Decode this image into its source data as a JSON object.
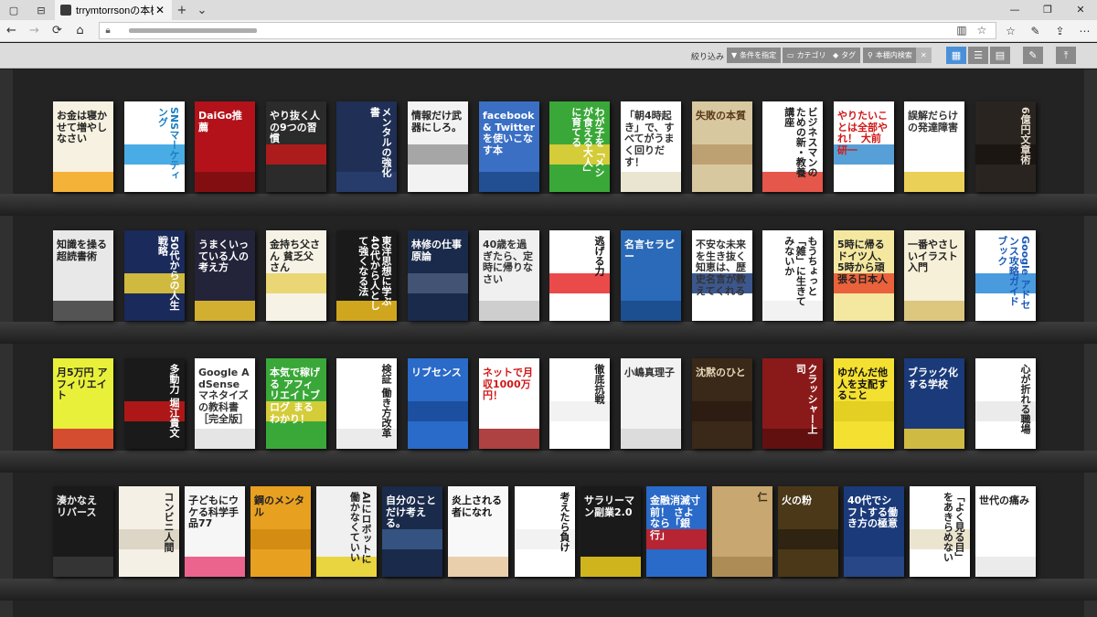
{
  "browser": {
    "tab_title": "trrymtorrsonの本棚 (trry",
    "tab_close": "✕",
    "new_tab": "+",
    "tab_menu": "⌄",
    "win_min": "—",
    "win_max": "❐",
    "win_close": "✕",
    "nav": {
      "back": "←",
      "forward": "→",
      "refresh": "⟳",
      "home": "⌂"
    },
    "address_icons": {
      "reading": "▥",
      "favorite": "☆"
    },
    "tools": [
      "☆",
      "✎",
      "⇪",
      "⋯"
    ]
  },
  "toolbar": {
    "filter_label": "絞り込み",
    "buttons": [
      {
        "icon": "▼",
        "label": "条件を指定"
      },
      {
        "icon": "▭",
        "label": "カテゴリ"
      },
      {
        "icon": "◆",
        "label": "タグ"
      },
      {
        "icon": "⚲",
        "label": "本棚内検索"
      }
    ],
    "clear": "✕",
    "views": [
      "▦",
      "☰",
      "▤"
    ],
    "settings": "✎",
    "top": "⤒"
  },
  "colors": {
    "accent": "#4a90d9",
    "shelf": "#232323"
  },
  "shelves": [
    {
      "books": [
        {
          "title": "お金は寝かせて増やしなさい",
          "bg": "#f6f1e0",
          "fg": "#222222",
          "band": "#f4a71b"
        },
        {
          "title": "SNSマーケティング",
          "bg": "#ffffff",
          "fg": "#1a7fc0",
          "band": "#2a9de0"
        },
        {
          "title": "DaiGo推薦",
          "bg": "#b3121a",
          "fg": "#ffffff",
          "band": "#7a0e12"
        },
        {
          "title": "やり抜く人の9つの習慣",
          "bg": "#2b2b2b",
          "fg": "#ffffff",
          "band": "#c41a1a"
        },
        {
          "title": "メンタルの強化書",
          "bg": "#1f2f55",
          "fg": "#ffffff",
          "band": "#2a3e70"
        },
        {
          "title": "情報だけ武器にしろ。",
          "bg": "#f2f2f2",
          "fg": "#222222",
          "band": "#999999"
        },
        {
          "title": "facebook & Twitterを使いこなす本",
          "bg": "#3a6fc4",
          "fg": "#ffffff",
          "band": "#1d4a8a"
        },
        {
          "title": "わが子を「メシが食える大人」に育てる",
          "bg": "#3aa838",
          "fg": "#ffffff",
          "band": "#f0d23a"
        },
        {
          "title": "「朝4時起き」で、すべてがうまく回りだす！",
          "bg": "#ffffff",
          "fg": "#333333",
          "band": "#e6e0c8"
        },
        {
          "title": "失敗の本質",
          "bg": "#d8c8a0",
          "fg": "#5a3a1a",
          "band": "#b89a6a"
        },
        {
          "title": "ビジネスマンのための新・教養講座",
          "bg": "#ffffff",
          "fg": "#222222",
          "band": "#e03a2a"
        },
        {
          "title": "やりたいことは全部やれ！ 大前研一",
          "bg": "#ffffff",
          "fg": "#d01818",
          "band": "#3a8fd0"
        },
        {
          "title": "誤解だらけの発達障害",
          "bg": "#ffffff",
          "fg": "#333333",
          "band": "#e8c83a"
        },
        {
          "title": "6億円文章術",
          "bg": "#2a2420",
          "fg": "#e8e0d0",
          "band": "#1a1410"
        }
      ]
    },
    {
      "books": [
        {
          "title": "知識を操る超読書術",
          "bg": "#e8e8e8",
          "fg": "#222222",
          "band": "#3a3a3a"
        },
        {
          "title": "50代からの人生戦略",
          "bg": "#1a2a5a",
          "fg": "#ffffff",
          "band": "#f0d23a"
        },
        {
          "title": "うまくいっている人の考え方",
          "bg": "#23233a",
          "fg": "#ffffff",
          "band": "#f2c830"
        },
        {
          "title": "金持ち父さん 貧乏父さん",
          "bg": "#f6f3e6",
          "fg": "#222222",
          "band": "#e8d060"
        },
        {
          "title": "東洋思想に学ぶ 40代から人として強くなる法",
          "bg": "#1a1a1a",
          "fg": "#ffffff",
          "band": "#f0c020"
        },
        {
          "title": "林修の仕事原論",
          "bg": "#1a2a4a",
          "fg": "#ffffff",
          "band": "#4a5a7a"
        },
        {
          "title": "40歳を過ぎたら、定時に帰りなさい",
          "bg": "#f0f0f0",
          "fg": "#333333",
          "band": "#c8c8c8"
        },
        {
          "title": "逃げる力",
          "bg": "#ffffff",
          "fg": "#111111",
          "band": "#e82a2a"
        },
        {
          "title": "名言セラピー",
          "bg": "#2a6ab8",
          "fg": "#ffffff",
          "band": "#1a4a88"
        },
        {
          "title": "不安な未来を生き抜く知恵は、歴史名言が教えてくれる",
          "bg": "#ffffff",
          "fg": "#333333",
          "band": "#1a3a7a"
        },
        {
          "title": "もうちょっと「雑」に生きてみないか",
          "bg": "#ffffff",
          "fg": "#222222",
          "band": "#f0f0f0"
        },
        {
          "title": "5時に帰るドイツ人、5時から頑張る日本人",
          "bg": "#f4e8a0",
          "fg": "#222222",
          "band": "#e84a2a"
        },
        {
          "title": "一番やさしいイラスト入門",
          "bg": "#f6f0d8",
          "fg": "#222222",
          "band": "#d8c070"
        },
        {
          "title": "Google アドセンス攻略ガイドブック",
          "bg": "#ffffff",
          "fg": "#1a5ab8",
          "band": "#2a8ad8"
        }
      ]
    },
    {
      "books": [
        {
          "title": "月5万円 アフィリエイト",
          "bg": "#e8f03a",
          "fg": "#222222",
          "band": "#d03030"
        },
        {
          "title": "多動力 堀江貴文",
          "bg": "#1a1a1a",
          "fg": "#ffffff",
          "band": "#c81818"
        },
        {
          "title": "Google AdSense マネタイズの教科書［完全版］",
          "bg": "#ffffff",
          "fg": "#333333",
          "band": "#e0e0e0"
        },
        {
          "title": "本気で稼げる アフィリエイトブログ まるわかり！",
          "bg": "#3aa838",
          "fg": "#ffffff",
          "band": "#f0d23a"
        },
        {
          "title": "検証 働き方改革",
          "bg": "#ffffff",
          "fg": "#222222",
          "band": "#e8e8e8"
        },
        {
          "title": "リブセンス",
          "bg": "#2a6ac8",
          "fg": "#ffffff",
          "band": "#1a4a98"
        },
        {
          "title": "ネットで月収1000万円！",
          "bg": "#ffffff",
          "fg": "#d01818",
          "band": "#a02020"
        },
        {
          "title": "徹底抗戦",
          "bg": "#ffffff",
          "fg": "#222222",
          "band": "#f0f0f0"
        },
        {
          "title": "小嶋真理子",
          "bg": "#f2f2f2",
          "fg": "#333333",
          "band": "#d8d8d8"
        },
        {
          "title": "沈黙のひと",
          "bg": "#3a2818",
          "fg": "#e8d8b8",
          "band": "#2a1a10"
        },
        {
          "title": "クラッシャー上司",
          "bg": "#8a1a1a",
          "fg": "#ffffff",
          "band": "#5a0e0e"
        },
        {
          "title": "ゆがんだ他人を支配すること",
          "bg": "#f4e030",
          "fg": "#111111",
          "band": "#e0cc20"
        },
        {
          "title": "ブラック化する学校",
          "bg": "#1a3a7a",
          "fg": "#ffffff",
          "band": "#f0d23a"
        },
        {
          "title": "心が折れる職場",
          "bg": "#ffffff",
          "fg": "#222222",
          "band": "#e8e8e8"
        }
      ]
    },
    {
      "books": [
        {
          "title": "湊かなえ リバース",
          "bg": "#1a1a1a",
          "fg": "#f0f0f0",
          "band": "#3a3a3a"
        },
        {
          "title": "コンビニ人間",
          "bg": "#f4f0e6",
          "fg": "#222222",
          "band": "#d8d0c0"
        },
        {
          "title": "子どもにウケる科学手品77",
          "bg": "#f6f6f6",
          "fg": "#222222",
          "band": "#e84a7a"
        },
        {
          "title": "鋼のメンタル",
          "bg": "#e8a020",
          "fg": "#222222",
          "band": "#d08810"
        },
        {
          "title": "AIにロボットに働かなくていい",
          "bg": "#f0f0f0",
          "fg": "#222222",
          "band": "#e8d020"
        },
        {
          "title": "自分のことだけ考える。",
          "bg": "#1a2a4a",
          "fg": "#ffffff",
          "band": "#3a5a8a"
        },
        {
          "title": "炎上される者になれ",
          "bg": "#f8f8f8",
          "fg": "#111111",
          "band": "#e8c8a0"
        },
        {
          "title": "考えたら負け",
          "bg": "#ffffff",
          "fg": "#111111",
          "band": "#f0f0f0"
        },
        {
          "title": "サラリーマン副業2.0",
          "bg": "#1a1a1a",
          "fg": "#ffffff",
          "band": "#f0d020"
        },
        {
          "title": "金融消滅寸前！ さよなら「銀行」",
          "bg": "#2a6ac8",
          "fg": "#ffffff",
          "band": "#d01818"
        },
        {
          "title": "仁",
          "bg": "#c8a870",
          "fg": "#3a2a1a",
          "band": "#a88850"
        },
        {
          "title": "火の粉",
          "bg": "#4a3818",
          "fg": "#ffffff",
          "band": "#2a2010"
        },
        {
          "title": "40代でシフトする働き方の極意",
          "bg": "#1a3a7a",
          "fg": "#ffffff",
          "band": "#2a4a8a"
        },
        {
          "title": "「よく見る目」をあきらめない",
          "bg": "#ffffff",
          "fg": "#222222",
          "band": "#e8e0c8"
        },
        {
          "title": "世代の痛み",
          "bg": "#ffffff",
          "fg": "#222222",
          "band": "#e8e8e8"
        }
      ]
    }
  ]
}
